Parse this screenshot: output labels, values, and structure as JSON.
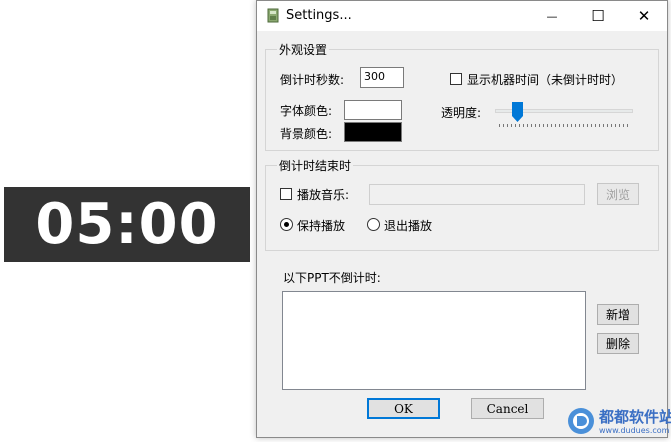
{
  "countdown": {
    "time": "05:00"
  },
  "window": {
    "title": "Settings...",
    "icon": "app-icon",
    "controls": {
      "minimize": "—",
      "maximize": "☐",
      "close": "✕"
    }
  },
  "appearance": {
    "group_label": "外观设置",
    "seconds_label": "倒计时秒数:",
    "seconds_value": "300",
    "show_machine_time_label": "显示机器时间（未倒计时时）",
    "show_machine_time_checked": false,
    "font_color_label": "字体颜色:",
    "font_color": "#ffffff",
    "bg_color_label": "背景颜色:",
    "bg_color": "#000000",
    "opacity_label": "透明度:",
    "opacity_level": 0.13
  },
  "end_action": {
    "group_label": "倒计时结束时",
    "play_music_label": "播放音乐:",
    "play_music_checked": false,
    "music_path": "",
    "browse_label": "浏览",
    "keep_playing_label": "保持播放",
    "exit_playing_label": "退出播放",
    "selected": "keep_playing"
  },
  "exclude": {
    "label": "以下PPT不倒计时:",
    "items": [],
    "add_label": "新增",
    "delete_label": "删除"
  },
  "footer": {
    "ok_label": "OK",
    "cancel_label": "Cancel"
  },
  "watermark": {
    "text": "都都软件站",
    "url": "www.dudues.com",
    "color": "#3b6fc4"
  }
}
